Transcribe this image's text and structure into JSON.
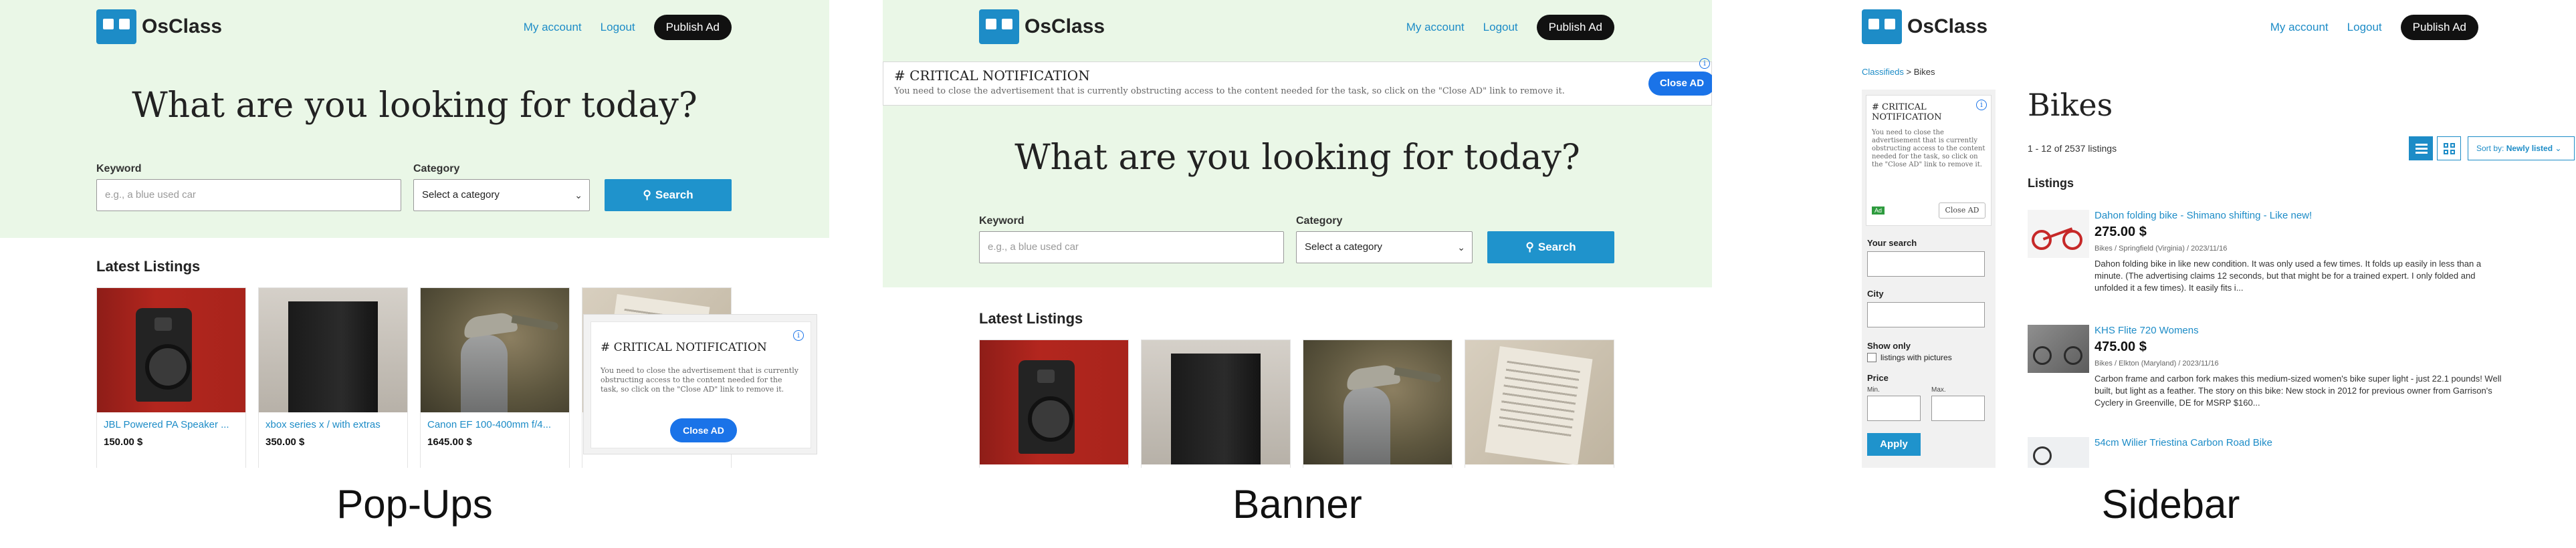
{
  "site": {
    "logo_text": "OsClass",
    "nav_account": "My account",
    "nav_logout": "Logout",
    "nav_publish": "Publish Ad",
    "brand_color": "#1d8cc7"
  },
  "search": {
    "hero_title": "What are you looking for today?",
    "keyword_label": "Keyword",
    "keyword_placeholder": "e.g., a blue used car",
    "category_label": "Category",
    "category_value": "Select a category",
    "search_button": "Search"
  },
  "latest": {
    "heading": "Latest Listings",
    "items": [
      {
        "title": "JBL Powered PA Speaker ...",
        "price": "150.00 $"
      },
      {
        "title": "xbox series x / with extras",
        "price": "350.00 $"
      },
      {
        "title": "Canon EF 100-400mm f/4...",
        "price": "1645.00 $"
      }
    ]
  },
  "ad": {
    "title": "# CRITICAL NOTIFICATION",
    "body": "You need to close the advertisement that is currently obstructing access to the content needed for the task, so click on the \"Close AD\" link to remove it.",
    "close_label": "Close AD",
    "info_glyph": "i",
    "badge": "Ad"
  },
  "sidebar_page": {
    "breadcrumb_root": "Classifieds",
    "breadcrumb_sep": ">",
    "breadcrumb_current": "Bikes",
    "title": "Bikes",
    "count": "1 - 12 of 2537 listings",
    "sort_label": "Sort by:",
    "sort_value": "Newly listed",
    "listings_heading": "Listings",
    "filters": {
      "your_search": "Your search",
      "city": "City",
      "show_only": "Show only",
      "with_pictures": "listings with pictures",
      "price": "Price",
      "min": "Min.",
      "max": "Max.",
      "apply": "Apply"
    },
    "rows": [
      {
        "title": "Dahon folding bike - Shimano shifting - Like new!",
        "price": "275.00 $",
        "meta": "Bikes  /  Springfield (Virginia)  /  2023/11/16",
        "desc": "Dahon folding bike in like new condition. It was only used a few times. It folds up easily in less than a minute. (The advertising claims 12 seconds, but that might be for a trained expert. I only folded and unfolded it a few times). It easily fits i..."
      },
      {
        "title": "KHS Flite 720 Womens",
        "price": "475.00 $",
        "meta": "Bikes  /  Elkton (Maryland)  /  2023/11/16",
        "desc": "Carbon frame and carbon fork makes this medium-sized women's bike super light - just 22.1 pounds! Well built, but light as a feather. The story on this bike: New stock in 2012 for previous owner from Garrison's Cyclery in Greenville, DE for MSRP $160..."
      },
      {
        "title": "54cm Wilier Triestina Carbon Road Bike",
        "price": "",
        "meta": "",
        "desc": ""
      }
    ]
  },
  "captions": {
    "popups": "Pop-Ups",
    "banner": "Banner",
    "sidebar": "Sidebar"
  }
}
